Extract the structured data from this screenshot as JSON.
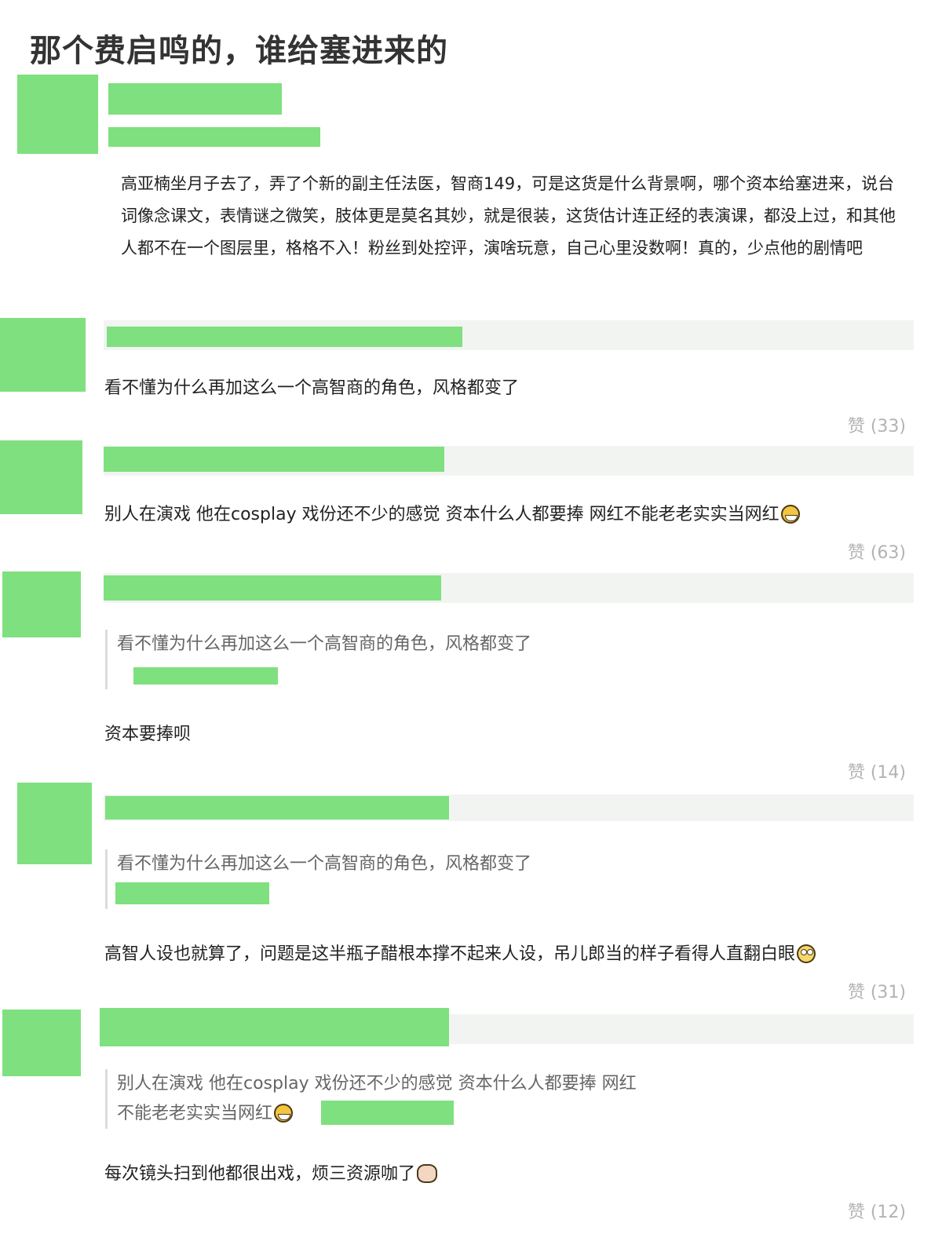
{
  "page": {
    "title": "那个费启鸣的，谁给塞进来的"
  },
  "post": {
    "body": "高亚楠坐月子去了，弄了个新的副主任法医，智商149，可是这货是什么背景啊，哪个资本给塞进来，说台词像念课文，表情谜之微笑，肢体更是莫名其妙，就是很装，这货估计连正经的表演课，都没上过，和其他人都不在一个图层里，格格不入！粉丝到处控评，演啥玩意，自己心里没数啊！真的，少点他的剧情吧"
  },
  "comments": [
    {
      "text": "看不懂为什么再加这么一个高智商的角色，风格都变了",
      "likes": "赞 (33)"
    },
    {
      "text": "别人在演戏 他在cosplay 戏份还不少的感觉 资本什么人都要捧 网红不能老老实实当网红",
      "emoji": "grinning-sweat-emoji",
      "likes": "赞 (63)"
    },
    {
      "quote": "看不懂为什么再加这么一个高智商的角色，风格都变了",
      "text": "资本要捧呗",
      "likes": "赞 (14)"
    },
    {
      "quote": "看不懂为什么再加这么一个高智商的角色，风格都变了",
      "text": "高智人设也就算了，问题是这半瓶子醋根本撑不起来人设，吊儿郎当的样子看得人直翻白眼",
      "emoji": "eye-roll-emoji",
      "likes": "赞 (31)"
    },
    {
      "quote_line1": "别人在演戏 他在cosplay 戏份还不少的感觉 资本什么人都要捧 网红",
      "quote_line2": "不能老老实实当网红",
      "text": "每次镜头扫到他都很出戏，烦三资源咖了",
      "emoji": "fist-emoji",
      "likes": "赞 (12)"
    }
  ]
}
